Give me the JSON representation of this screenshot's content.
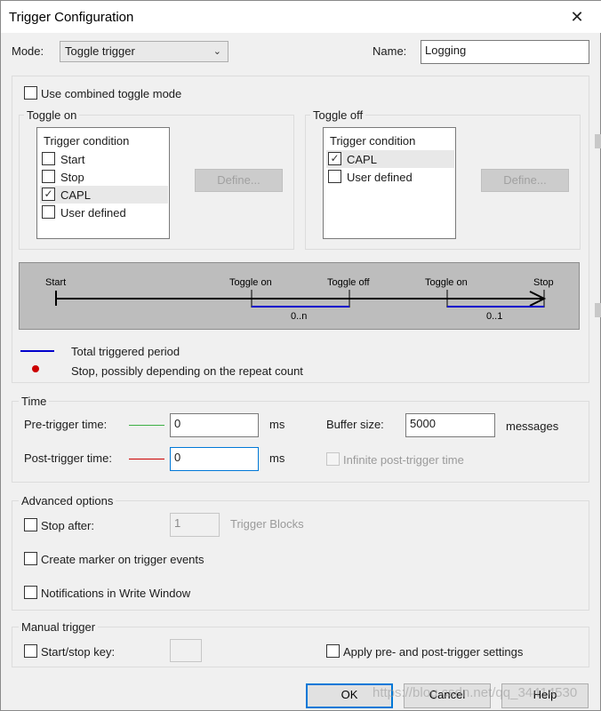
{
  "window": {
    "title": "Trigger Configuration",
    "close_glyph": "✕"
  },
  "mode": {
    "label": "Mode:",
    "value": "Toggle trigger"
  },
  "name": {
    "label": "Name:",
    "value": "Logging"
  },
  "combined_toggle": {
    "label": "Use combined toggle mode",
    "checked": false
  },
  "toggle_on": {
    "title": "Toggle on",
    "list_header": "Trigger condition",
    "items": [
      {
        "label": "Start",
        "checked": false
      },
      {
        "label": "Stop",
        "checked": false
      },
      {
        "label": "CAPL",
        "checked": true
      },
      {
        "label": "User defined",
        "checked": false
      }
    ],
    "define_label": "Define..."
  },
  "toggle_off": {
    "title": "Toggle off",
    "list_header": "Trigger condition",
    "items": [
      {
        "label": "CAPL",
        "checked": true
      },
      {
        "label": "User defined",
        "checked": false
      }
    ],
    "define_label": "Define..."
  },
  "diagram": {
    "labels": [
      "Start",
      "Toggle on",
      "Toggle off",
      "Toggle on",
      "Stop"
    ],
    "range1": "0..n",
    "range2": "0..1",
    "legend_period": "Total triggered period",
    "legend_stop": "Stop, possibly depending on the repeat count",
    "period_color": "#0000cc",
    "stop_color": "#cc0000"
  },
  "time": {
    "title": "Time",
    "pre_label": "Pre-trigger time:",
    "pre_value": "0",
    "post_label": "Post-trigger time:",
    "post_value": "0",
    "unit": "ms",
    "buffer_label": "Buffer size:",
    "buffer_value": "5000",
    "buffer_unit": "messages",
    "infinite_label": "Infinite post-trigger time",
    "pre_color": "#3cb043",
    "post_color": "#cc0000"
  },
  "advanced": {
    "title": "Advanced options",
    "stop_after_label": "Stop after:",
    "stop_after_value": "1",
    "blocks_label": "Trigger Blocks",
    "marker_label": "Create marker on trigger events",
    "notify_label": "Notifications in Write Window"
  },
  "manual": {
    "title": "Manual trigger",
    "key_label": "Start/stop key:",
    "apply_label": "Apply pre- and post-trigger settings"
  },
  "buttons": {
    "ok": "OK",
    "cancel": "Cancel",
    "help": "Help"
  },
  "watermark": "https://blog.csdn.net/qq_34414530"
}
